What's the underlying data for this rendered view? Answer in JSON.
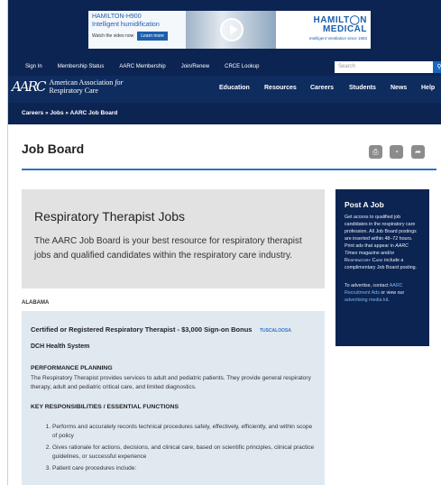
{
  "ad": {
    "title": "HAMILTON-H900",
    "subtitle": "Intelligent humidification",
    "watch": "Watch the video now",
    "learn": "Learn more",
    "brand_line1": "HAMILT◯N",
    "brand_line2": "MEDICAL",
    "tagline": "Intelligent Ventilation since 1983"
  },
  "topbar": {
    "links": [
      "Sign In",
      "Membership Status",
      "AARC Membership",
      "Join/Renew",
      "CRCE Lookup"
    ],
    "search_placeholder": "Search"
  },
  "logo": {
    "mark": "AARC",
    "line1": "American Association",
    "line1_italic": "for",
    "line2": "Respiratory Care"
  },
  "nav": {
    "items": [
      "Education",
      "Resources",
      "Careers",
      "Students",
      "News",
      "Help"
    ]
  },
  "breadcrumb": "Careers » Jobs » AARC Job Board",
  "page": {
    "title": "Job Board",
    "tools": [
      "print-icon",
      "rss-icon",
      "share-icon"
    ]
  },
  "intro": {
    "heading": "Respiratory Therapist Jobs",
    "text": "The AARC Job Board is your best resource for respiratory therapist jobs and qualified candidates within the respiratory care industry."
  },
  "sidebar": {
    "heading": "Post A Job",
    "text_a": "Get access to qualified job candidates in the respiratory care profession. All Job Board postings are inserted within 48–72 hours. Print ads that appear in ",
    "text_b": "AARC Times",
    "text_c": " magazine and/or ",
    "text_d": "Respiratory Care",
    "text_e": " include a complimentary Job Board posting.",
    "contact_a": "To advertise, contact ",
    "contact_link1": "AARC Recruitment Ads",
    "contact_b": " or view our ",
    "contact_link2": "advertising media kit",
    "contact_c": "."
  },
  "listing": {
    "state": "ALABAMA",
    "job_title": "Certified or Registered Respiratory Therapist - $3,000 Sign-on Bonus",
    "location": "TUSCALOOSA",
    "organization": "DCH Health System",
    "section1": "PERFORMANCE PLANNING",
    "description": "The Respiratory Therapist provides services to adult and pediatric patients. They provide general respiratory therapy, adult and pediatric critical care, and limited diagnostics.",
    "section2": "KEY RESPONSIBILITIES / ESSENTIAL FUNCTIONS",
    "items": [
      "Performs and accurately records technical procedures safely, effectively, efficiently, and within scope of policy",
      "Gives rationale for actions, decisions, and clinical care, based on scientific principles, clinical practice guidelines, or successful experience",
      "Patient care procedures include:"
    ]
  }
}
